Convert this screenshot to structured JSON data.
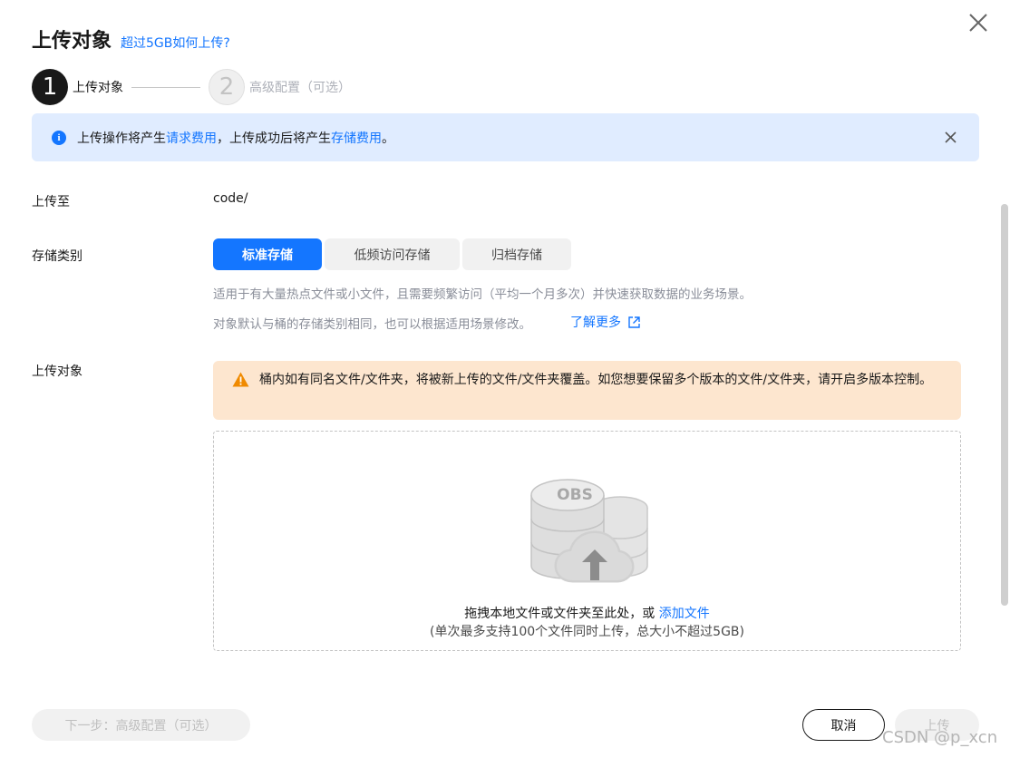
{
  "header": {
    "title": "上传对象",
    "help_link": "超过5GB如何上传?"
  },
  "steps": [
    {
      "num": "1",
      "label": "上传对象",
      "state": "active"
    },
    {
      "num": "2",
      "label": "高级配置（可选）",
      "state": "inactive"
    }
  ],
  "info": {
    "text_1": "上传操作将产生",
    "link_1": "请求费用",
    "text_2": "，上传成功后将产生",
    "link_2": "存储费用",
    "text_3": "。"
  },
  "form": {
    "upload_to_label": "上传至",
    "upload_to_value": "code/",
    "storage_class_label": "存储类别",
    "storage_classes": [
      "标准存储",
      "低频访问存储",
      "归档存储"
    ],
    "selected_storage_class": "标准存储",
    "storage_desc": "适用于有大量热点文件或小文件，且需要频繁访问（平均一个月多次）并快速获取数据的业务场景。",
    "storage_note": "对象默认与桶的存储类别相同，也可以根据适用场景修改。",
    "learn_more": "了解更多",
    "upload_object_label": "上传对象"
  },
  "warning": {
    "text": "桶内如有同名文件/文件夹，将被新上传的文件/文件夹覆盖。如您想要保留多个版本的文件/文件夹，请开启多版本控制。"
  },
  "dropzone": {
    "badge": "OBS",
    "text": "拖拽本地文件或文件夹至此处，或 ",
    "link": "添加文件",
    "subtext": "(单次最多支持100个文件同时上传，总大小不超过5GB)"
  },
  "footer": {
    "next_label": "下一步：高级配置（可选）",
    "cancel_label": "取消",
    "upload_label": "上传"
  },
  "watermark": "CSDN @p_xcn",
  "colors": {
    "accent": "#1476ff",
    "info_bg": "#e0ecff",
    "warn_bg": "#fde6cf",
    "warn_icon": "#f08a00"
  }
}
